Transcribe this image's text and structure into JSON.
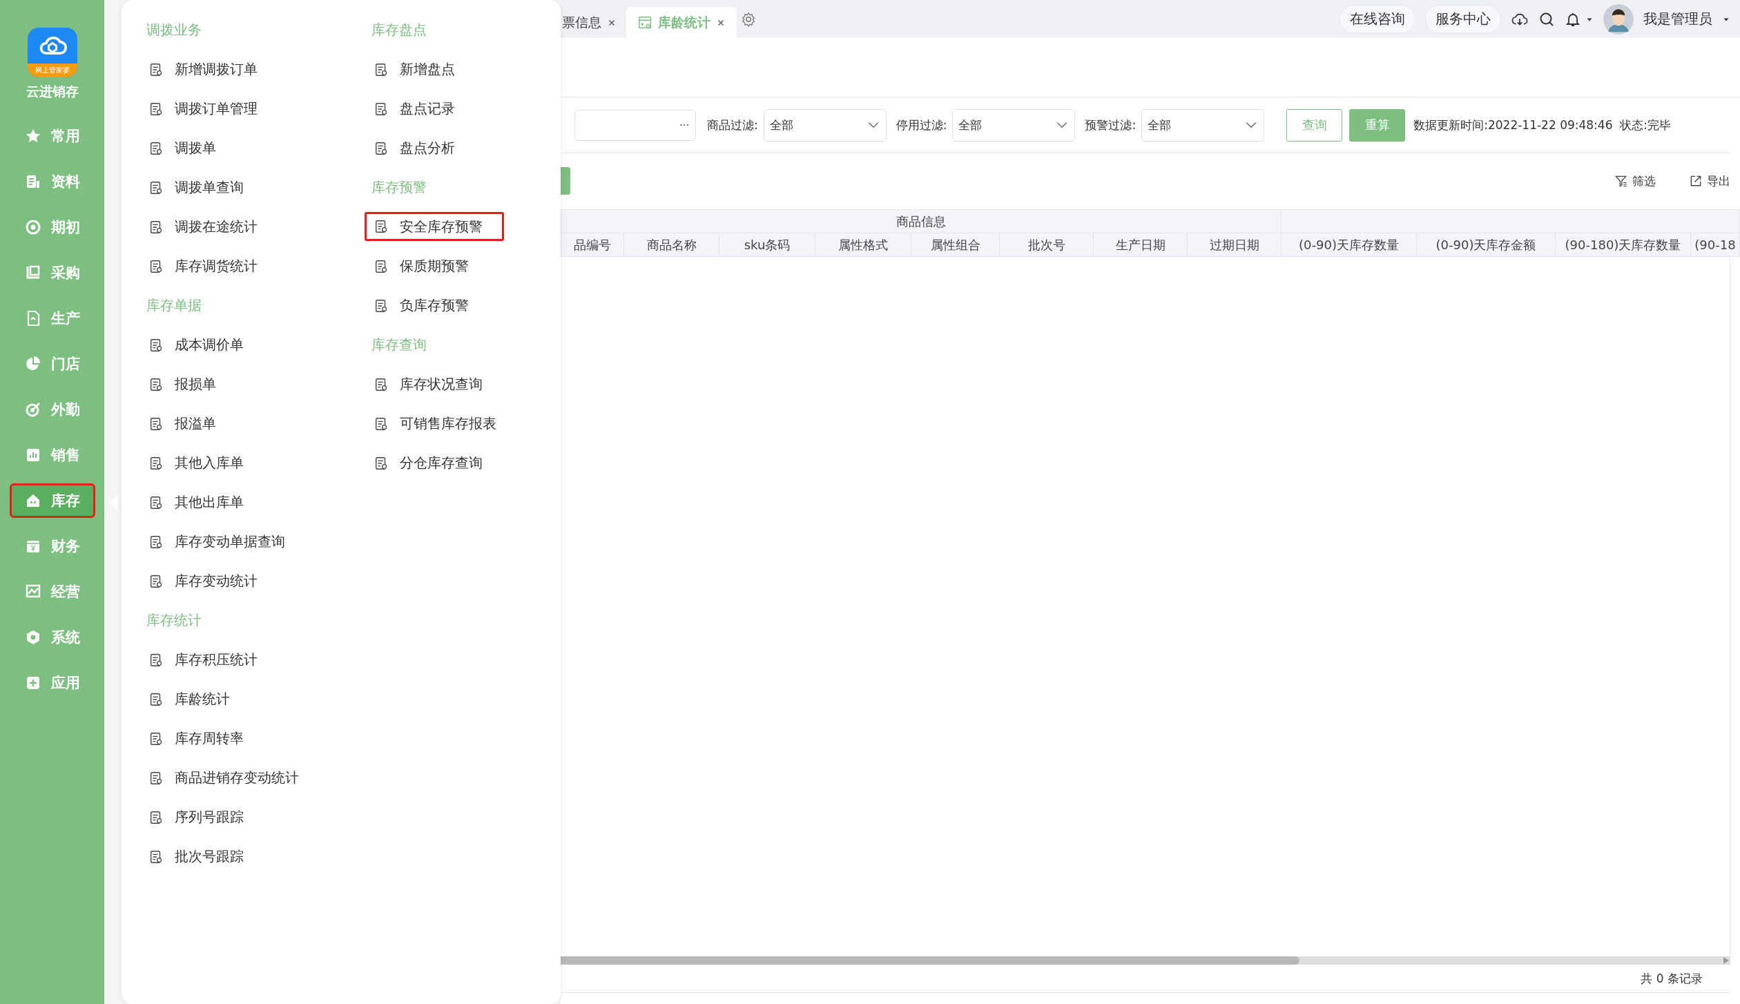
{
  "app": {
    "name": "云进销存",
    "logo_badge": "网上管家婆"
  },
  "sidebar": {
    "items": [
      {
        "label": "常用",
        "selected": false,
        "highlighted": false
      },
      {
        "label": "资料",
        "selected": false,
        "highlighted": false
      },
      {
        "label": "期初",
        "selected": false,
        "highlighted": false
      },
      {
        "label": "采购",
        "selected": false,
        "highlighted": false
      },
      {
        "label": "生产",
        "selected": false,
        "highlighted": false
      },
      {
        "label": "门店",
        "selected": false,
        "highlighted": false
      },
      {
        "label": "外勤",
        "selected": false,
        "highlighted": false
      },
      {
        "label": "销售",
        "selected": false,
        "highlighted": false
      },
      {
        "label": "库存",
        "selected": true,
        "highlighted": true
      },
      {
        "label": "财务",
        "selected": false,
        "highlighted": false
      },
      {
        "label": "经营",
        "selected": false,
        "highlighted": false
      },
      {
        "label": "系统",
        "selected": false,
        "highlighted": false
      },
      {
        "label": "应用",
        "selected": false,
        "highlighted": false
      }
    ]
  },
  "menu": {
    "columns": [
      {
        "sections": [
          {
            "title": "调拨业务",
            "items": [
              {
                "label": "新增调拨订单",
                "highlighted": false
              },
              {
                "label": "调拨订单管理",
                "highlighted": false
              },
              {
                "label": "调拨单",
                "highlighted": false
              },
              {
                "label": "调拨单查询",
                "highlighted": false
              },
              {
                "label": "调拨在途统计",
                "highlighted": false
              },
              {
                "label": "库存调货统计",
                "highlighted": false
              }
            ]
          },
          {
            "title": "库存单据",
            "items": [
              {
                "label": "成本调价单",
                "highlighted": false
              },
              {
                "label": "报损单",
                "highlighted": false
              },
              {
                "label": "报溢单",
                "highlighted": false
              },
              {
                "label": "其他入库单",
                "highlighted": false
              },
              {
                "label": "其他出库单",
                "highlighted": false
              },
              {
                "label": "库存变动单据查询",
                "highlighted": false
              },
              {
                "label": "库存变动统计",
                "highlighted": false
              }
            ]
          },
          {
            "title": "库存统计",
            "items": [
              {
                "label": "库存积压统计",
                "highlighted": false
              },
              {
                "label": "库龄统计",
                "highlighted": false
              },
              {
                "label": "库存周转率",
                "highlighted": false
              },
              {
                "label": "商品进销存变动统计",
                "highlighted": false
              },
              {
                "label": "序列号跟踪",
                "highlighted": false
              },
              {
                "label": "批次号跟踪",
                "highlighted": false
              }
            ]
          }
        ]
      },
      {
        "sections": [
          {
            "title": "库存盘点",
            "items": [
              {
                "label": "新增盘点",
                "highlighted": false
              },
              {
                "label": "盘点记录",
                "highlighted": false
              },
              {
                "label": "盘点分析",
                "highlighted": false
              }
            ]
          },
          {
            "title": "库存预警",
            "items": [
              {
                "label": "安全库存预警",
                "highlighted": true
              },
              {
                "label": "保质期预警",
                "highlighted": false
              },
              {
                "label": "负库存预警",
                "highlighted": false
              }
            ]
          },
          {
            "title": "库存查询",
            "items": [
              {
                "label": "库存状况查询",
                "highlighted": false
              },
              {
                "label": "可销售库存报表",
                "highlighted": false
              },
              {
                "label": "分仓库存查询",
                "highlighted": false
              }
            ]
          }
        ]
      }
    ]
  },
  "tabs": [
    {
      "label": "票信息",
      "selected": false
    },
    {
      "label": "库龄统计",
      "selected": true
    }
  ],
  "header": {
    "buttons": [
      "在线咨询",
      "服务中心"
    ],
    "user": "我是管理员"
  },
  "filters": [
    {
      "label": "商品过滤:",
      "value": "全部"
    },
    {
      "label": "停用过滤:",
      "value": "全部"
    },
    {
      "label": "预警过滤:",
      "value": "全部"
    }
  ],
  "actions": {
    "query": "查询",
    "recalc": "重算",
    "status": "数据更新时间:2022-11-22 09:48:46  状态:完毕"
  },
  "toolbar": [
    "筛选",
    "导出"
  ],
  "table": {
    "groups": [
      {
        "label": "商品信息",
        "columns": [
          "品编号",
          "商品名称",
          "sku条码",
          "属性格式",
          "属性组合",
          "批次号",
          "生产日期",
          "过期日期"
        ]
      },
      {
        "columns": [
          "(0-90)天库存数量",
          "(0-90)天库存金额",
          "(90-180)天库存数量",
          "(90-18"
        ]
      }
    ]
  },
  "footer": {
    "total": "共 0 条记录"
  }
}
